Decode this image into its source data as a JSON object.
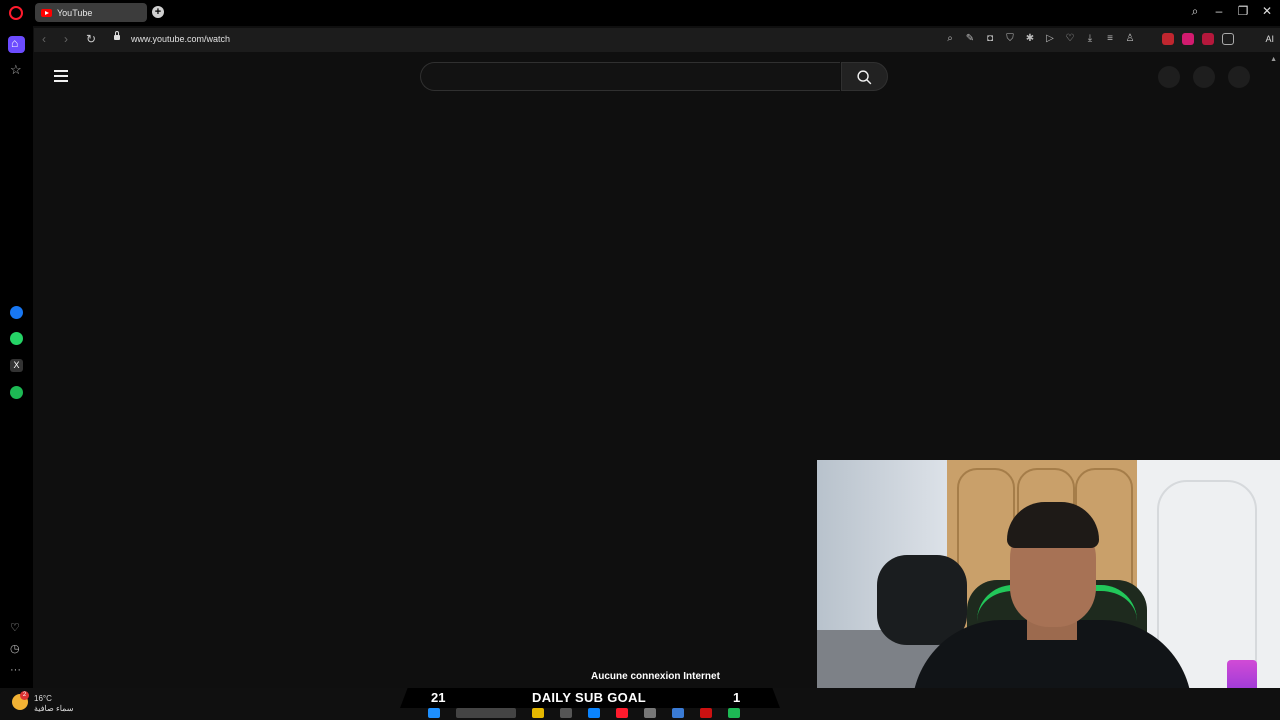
{
  "browser": {
    "tab_title": "YouTube",
    "url": "www.youtube.com/watch",
    "ai_label": "AI"
  },
  "window_controls": [
    "search-icon",
    "minimize-icon",
    "restore-icon",
    "close-icon"
  ],
  "sidebar": {
    "items": [
      "home-icon",
      "star-icon",
      "messenger-icon",
      "whatsapp-icon",
      "x-icon",
      "spotify-icon",
      "heart-icon",
      "history-icon",
      "more-icon"
    ]
  },
  "youtube": {
    "search_placeholder": ""
  },
  "notification": {
    "text": "Aucune connexion Internet"
  },
  "overlay": {
    "goal_current": "21",
    "goal_title": "DAILY SUB GOAL",
    "goal_target": "1"
  },
  "taskbar": {
    "temperature": "16°C",
    "weather_desc": "سماء صافية",
    "weather_badge": "2"
  },
  "colors": {
    "opera_red": "#ff1b2d",
    "accent_purple": "#6c4cff",
    "page_bg": "#0f0f0f"
  }
}
